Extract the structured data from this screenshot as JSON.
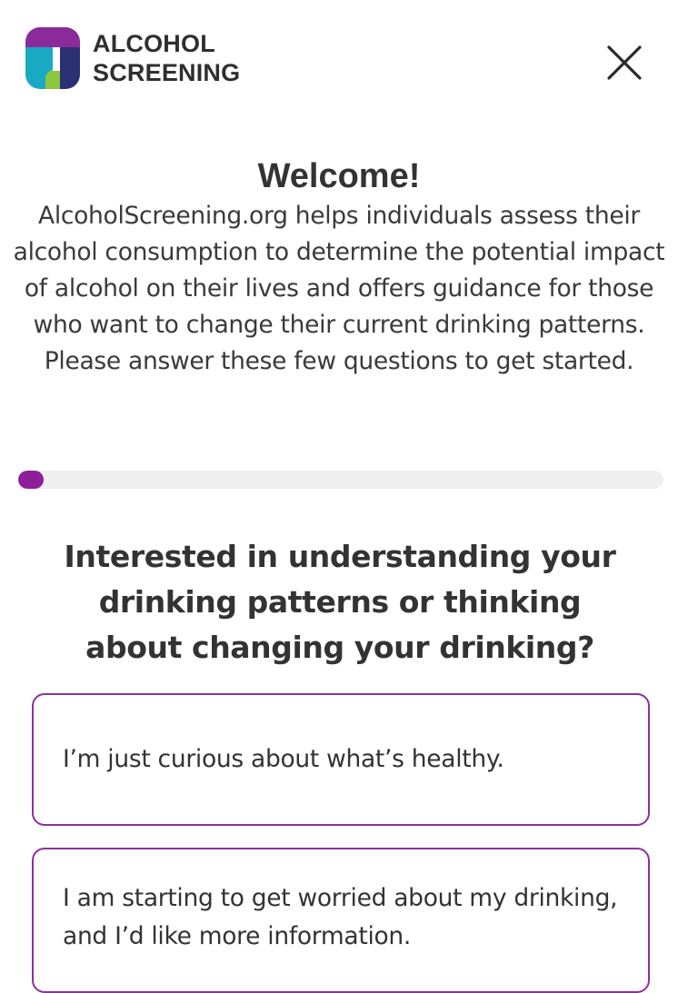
{
  "header": {
    "logo_line1": "ALCOHOL",
    "logo_line2": "SCREENING",
    "close_icon": "close-icon"
  },
  "welcome": {
    "title": "Welcome!",
    "description": "AlcoholScreening.org helps individuals assess their alcohol consumption to determine the potential impact of alcohol on their lives and offers guidance for those who want to change their current drinking patterns.",
    "instruction": "Please answer these few questions to get started."
  },
  "progress": {
    "value_percent": 4
  },
  "question": {
    "text": "Interested in understanding your drinking patterns or thinking about changing your drinking?"
  },
  "options": [
    {
      "label": "I’m just curious about what’s healthy."
    },
    {
      "label": "I am starting to get worried about my drinking, and I’d like more information."
    }
  ],
  "colors": {
    "accent": "#8e1f9b",
    "progress_track": "#efefef",
    "logo_purple": "#8b2a9b",
    "logo_teal": "#1aa9c2",
    "logo_navy": "#2b2f73",
    "logo_green": "#8cc63f"
  }
}
